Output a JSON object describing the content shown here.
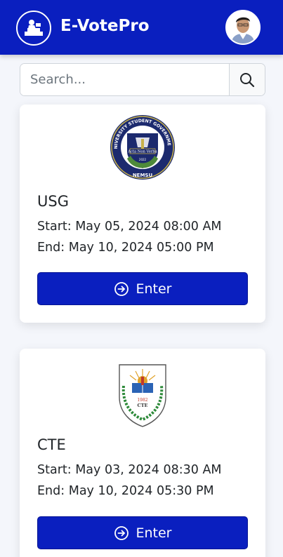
{
  "app": {
    "title": "E-VotePro"
  },
  "search": {
    "placeholder": "Search..."
  },
  "elections": [
    {
      "name": "USG",
      "start": "Start: May 05, 2024 08:00 AM",
      "end": "End: May 10, 2024 05:00 PM",
      "button_label": "Enter",
      "logo_ring_text": "UNIVERSITY STUDENT GOVERNMENT",
      "logo_motto": "Acta Non Verba",
      "logo_bottom": "NEMSU",
      "logo_year": "2022"
    },
    {
      "name": "CTE",
      "start": "Start: May 03, 2024 08:30 AM",
      "end": "End: May 10, 2024 05:30 PM",
      "button_label": "Enter",
      "logo_year": "1982",
      "logo_bottom": "CTE"
    }
  ],
  "colors": {
    "primary": "#0a1fbf",
    "background": "#f4f6fb",
    "card": "#ffffff"
  }
}
